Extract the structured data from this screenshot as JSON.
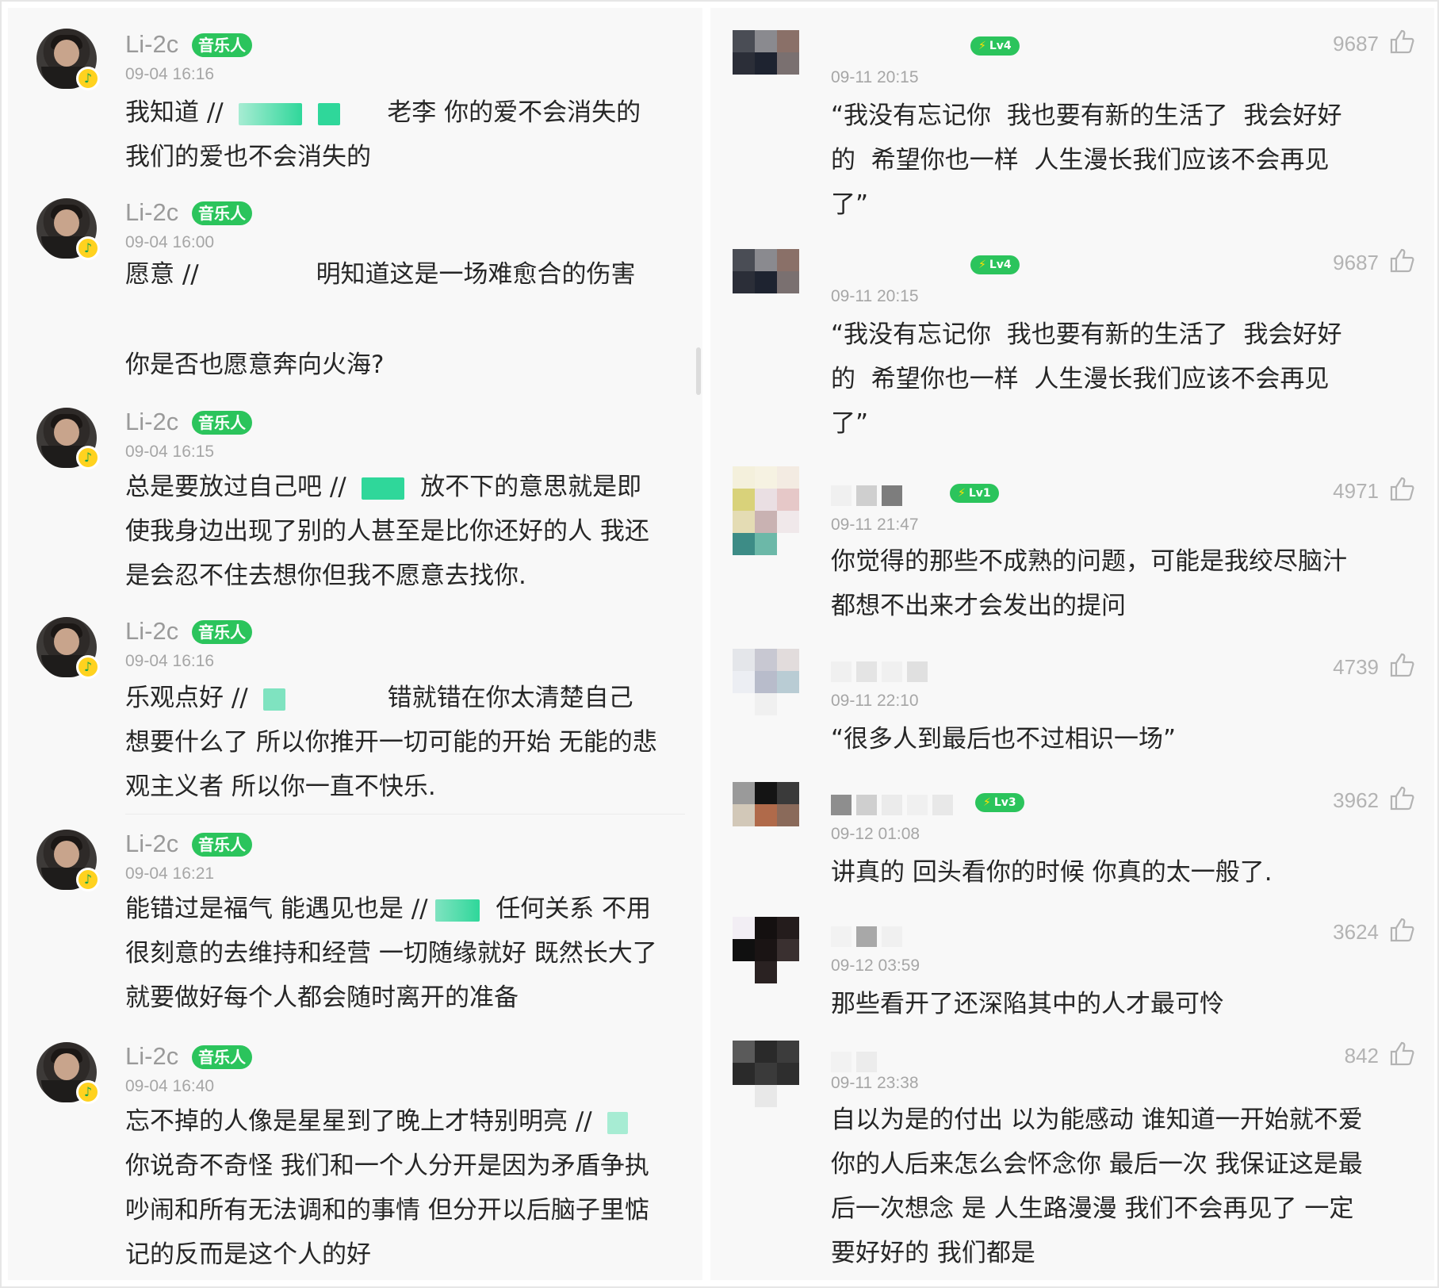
{
  "left": {
    "comments": [
      {
        "user": "Li-2c",
        "tag": "音乐人",
        "time": "09-04 16:16",
        "text_a": "我知道 //",
        "text_b": "老李 你的爱不会消失的",
        "text_c": "我们的爱也不会消失的"
      },
      {
        "user": "Li-2c",
        "tag": "音乐人",
        "time": "09-04 16:00",
        "text_a": "愿意 //",
        "text_b": "明知道这是一场难愈合的伤害",
        "text_c": "你是否也愿意奔向火海?"
      },
      {
        "user": "Li-2c",
        "tag": "音乐人",
        "time": "09-04 16:15",
        "text_a": "总是要放过自己吧 //",
        "text_b": "放不下的意思就是即",
        "text_c": "使我身边出现了别的人甚至是比你还好的人 我还",
        "text_d": "是会忍不住去想你但我不愿意去找你."
      },
      {
        "user": "Li-2c",
        "tag": "音乐人",
        "time": "09-04 16:16",
        "text_a": "乐观点好 //",
        "text_b": "错就错在你太清楚自己",
        "text_c": "想要什么了 所以你推开一切可能的开始 无能的悲",
        "text_d": "观主义者 所以你一直不快乐."
      },
      {
        "user": "Li-2c",
        "tag": "音乐人",
        "time": "09-04 16:21",
        "text_a": "能错过是福气 能遇见也是 //",
        "text_b": "任何关系 不用",
        "text_c": "很刻意的去维持和经营 一切随缘就好 既然长大了",
        "text_d": "就要做好每个人都会随时离开的准备"
      },
      {
        "user": "Li-2c",
        "tag": "音乐人",
        "time": "09-04 16:40",
        "text_a": "忘不掉的人像是星星到了晚上才特别明亮 //",
        "text_c": "你说奇不奇怪 我们和一个人分开是因为矛盾争执",
        "text_d": "吵闹和所有无法调和的事情 但分开以后脑子里惦",
        "text_e": "记的反而是这个人的好"
      }
    ]
  },
  "right": {
    "comments": [
      {
        "level": "Lv4",
        "likes": "9687",
        "time": "09-11 20:15",
        "lines": [
          "“我没有忘记你  我也要有新的生活了  我会好好",
          "的  希望你也一样  人生漫长我们应该不会再见",
          "了”"
        ]
      },
      {
        "level": "Lv4",
        "likes": "9687",
        "time": "09-11 20:15",
        "lines": [
          "“我没有忘记你  我也要有新的生活了  我会好好",
          "的  希望你也一样  人生漫长我们应该不会再见",
          "了”"
        ]
      },
      {
        "level": "Lv1",
        "likes": "4971",
        "time": "09-11 21:47",
        "lines": [
          "你觉得的那些不成熟的问题，可能是我绞尽脑汁",
          "都想不出来才会发出的提问"
        ]
      },
      {
        "level": "",
        "likes": "4739",
        "time": "09-11 22:10",
        "lines": [
          "“很多人到最后也不过相识一场”"
        ]
      },
      {
        "level": "Lv3",
        "likes": "3962",
        "time": "09-12 01:08",
        "lines": [
          "讲真的 回头看你的时候 你真的太一般了."
        ]
      },
      {
        "level": "",
        "likes": "3624",
        "time": "09-12 03:59",
        "lines": [
          "那些看开了还深陷其中的人才最可怜"
        ]
      },
      {
        "level": "",
        "likes": "842",
        "time": "09-11 23:38",
        "lines": [
          "自以为是的付出 以为能感动 谁知道一开始就不爱",
          "你的人后来怎么会怀念你 最后一次 我保证这是最",
          "后一次想念 是 人生路漫漫 我们不会再见了 一定",
          "要好好的 我们都是"
        ]
      }
    ]
  },
  "icons": {
    "like": "thumbs-up-icon",
    "badge": "music-note-icon",
    "bolt": "lightning-icon"
  },
  "colors": {
    "accent": "#2bc45c",
    "blur_green": "#2fd79a"
  }
}
